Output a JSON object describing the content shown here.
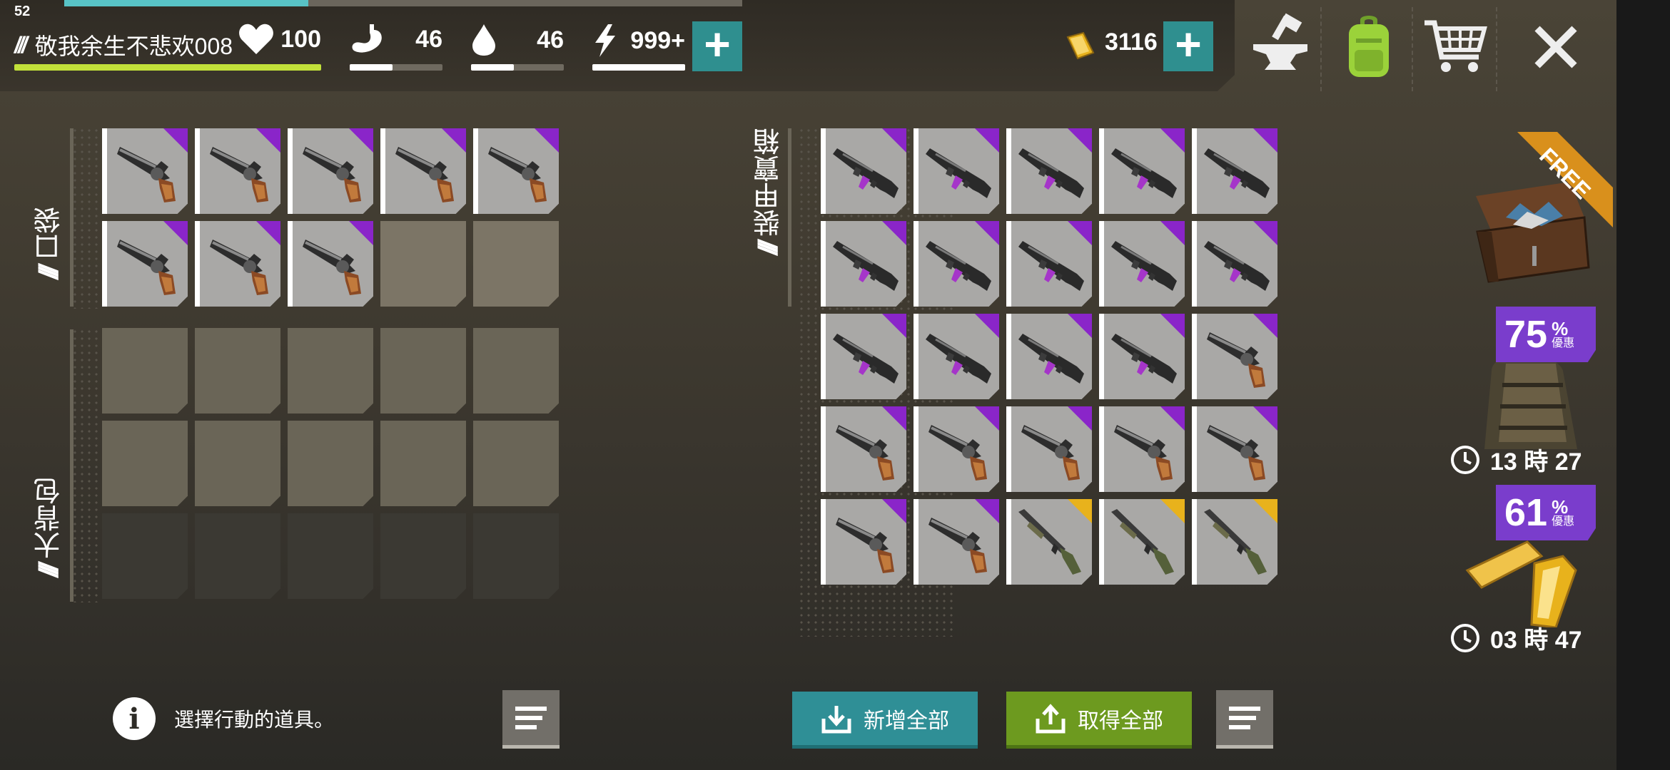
{
  "status": {
    "level": "52",
    "xp_fraction": 0.36
  },
  "player": {
    "name": "敬我余生不悲欢008",
    "health_fraction": 1.0
  },
  "stats": {
    "health": {
      "value": "100",
      "icon": "heart-icon"
    },
    "food": {
      "value": "46",
      "icon": "stomach-icon",
      "fraction": 0.46
    },
    "water": {
      "value": "46",
      "icon": "water-drop-icon",
      "fraction": 0.46
    },
    "energy": {
      "value": "999+",
      "icon": "lightning-icon",
      "fraction": 1.0
    }
  },
  "currency": {
    "gold": "3116",
    "icon": "gold-bar-icon"
  },
  "toolbar": [
    "anvil-icon",
    "backpack-icon",
    "cart-icon",
    "close-icon"
  ],
  "pocket": {
    "label": "口袋",
    "slots": [
      "revolver",
      "revolver",
      "revolver",
      "revolver",
      "revolver",
      "revolver",
      "revolver",
      "revolver",
      "",
      ""
    ]
  },
  "backpack": {
    "label": "大背包",
    "slots": 15
  },
  "chest": {
    "label": "裝甲寶箱",
    "slots": [
      {
        "item": "rifle",
        "rarity": "purple"
      },
      {
        "item": "rifle",
        "rarity": "purple"
      },
      {
        "item": "rifle",
        "rarity": "purple"
      },
      {
        "item": "rifle",
        "rarity": "purple"
      },
      {
        "item": "rifle",
        "rarity": "purple"
      },
      {
        "item": "rifle",
        "rarity": "purple"
      },
      {
        "item": "rifle",
        "rarity": "purple"
      },
      {
        "item": "rifle",
        "rarity": "purple"
      },
      {
        "item": "rifle",
        "rarity": "purple"
      },
      {
        "item": "rifle",
        "rarity": "purple"
      },
      {
        "item": "rifle",
        "rarity": "purple"
      },
      {
        "item": "rifle",
        "rarity": "purple"
      },
      {
        "item": "rifle",
        "rarity": "purple"
      },
      {
        "item": "rifle",
        "rarity": "purple"
      },
      {
        "item": "revolver",
        "rarity": "purple"
      },
      {
        "item": "revolver",
        "rarity": "purple"
      },
      {
        "item": "revolver",
        "rarity": "purple"
      },
      {
        "item": "revolver",
        "rarity": "purple"
      },
      {
        "item": "revolver",
        "rarity": "purple"
      },
      {
        "item": "revolver",
        "rarity": "purple"
      },
      {
        "item": "revolver",
        "rarity": "purple"
      },
      {
        "item": "revolver",
        "rarity": "purple"
      },
      {
        "item": "shotgun",
        "rarity": "gold"
      },
      {
        "item": "shotgun",
        "rarity": "gold"
      },
      {
        "item": "shotgun",
        "rarity": "gold"
      }
    ]
  },
  "offers": {
    "free_label": "FREE",
    "offer1": {
      "discount": "75",
      "percent": "%",
      "tag": "優惠",
      "time": "13 時 27"
    },
    "offer2": {
      "discount": "61",
      "percent": "%",
      "tag": "優惠",
      "time": "03 時 47"
    }
  },
  "footer": {
    "hint": "選擇行動的道具。",
    "add_all": "新增全部",
    "take_all": "取得全部"
  },
  "colors": {
    "purple": "#8a25c9",
    "gold": "#e8b21c",
    "teal": "#2f8f8f",
    "green": "#6d9a1f",
    "health": "#c2e13a",
    "xp": "#58c3c6"
  }
}
